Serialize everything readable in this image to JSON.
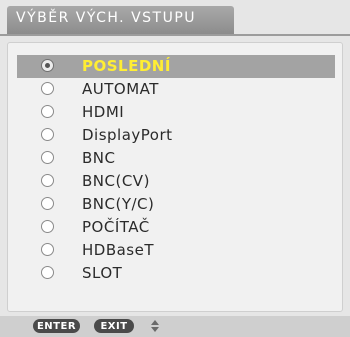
{
  "menu": {
    "title": "VÝBĚR VÝCH. VSTUPU",
    "items": [
      {
        "label": "POSLEDNÍ",
        "selected": true
      },
      {
        "label": "AUTOMAT",
        "selected": false
      },
      {
        "label": "HDMI",
        "selected": false
      },
      {
        "label": "DisplayPort",
        "selected": false
      },
      {
        "label": "BNC",
        "selected": false
      },
      {
        "label": "BNC(CV)",
        "selected": false
      },
      {
        "label": "BNC(Y/C)",
        "selected": false
      },
      {
        "label": "POČÍTAČ",
        "selected": false
      },
      {
        "label": "HDBaseT",
        "selected": false
      },
      {
        "label": "SLOT",
        "selected": false
      }
    ]
  },
  "footer": {
    "enter_label": "ENTER",
    "exit_label": "EXIT",
    "nav_icon": "up-down-arrows-icon"
  },
  "colors": {
    "selected_text": "#ffee33",
    "selected_bg": "#a3a3a3",
    "title_bg": "#8c8c8c"
  }
}
